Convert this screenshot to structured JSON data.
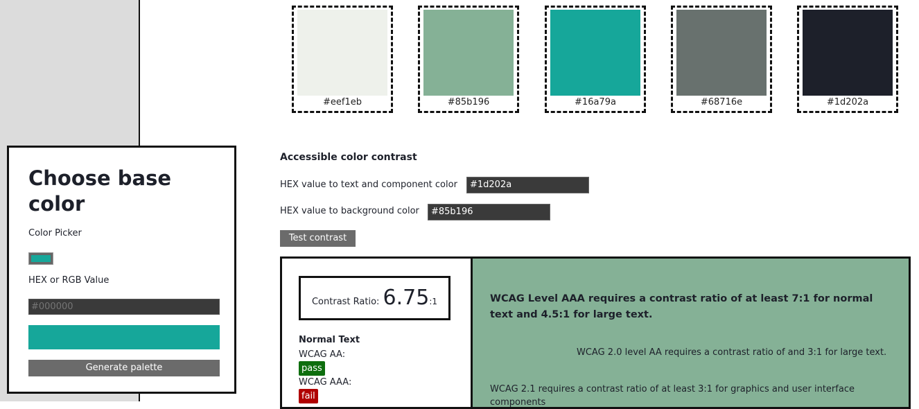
{
  "palette": [
    {
      "hex": "#eef1eb",
      "label": "#eef1eb"
    },
    {
      "hex": "#85b196",
      "label": "#85b196"
    },
    {
      "hex": "#16a79a",
      "label": "#16a79a"
    },
    {
      "hex": "#68716e",
      "label": "#68716e"
    },
    {
      "hex": "#1d202a",
      "label": "#1d202a"
    }
  ],
  "picker": {
    "title": "Choose base color",
    "color_picker_label": "Color Picker",
    "color_picker_value": "#16a79a",
    "hex_rgb_label": "HEX or RGB Value",
    "hex_input_placeholder": "#000000",
    "preview_color": "#16a79a",
    "generate_button": "Generate palette"
  },
  "contrast": {
    "heading": "Accessible color contrast",
    "text_color_label": "HEX value to text and component color",
    "text_color_value": "#1d202a",
    "bg_color_label": "HEX value to background color",
    "bg_color_value": "#85b196",
    "test_button": "Test contrast",
    "ratio_label": "Contrast Ratio:",
    "ratio_value": "6.75",
    "ratio_suffix": ":1",
    "normal_text_heading": "Normal Text",
    "levels": [
      {
        "label": "WCAG AA:",
        "result": "pass"
      },
      {
        "label": "WCAG AAA:",
        "result": "fail"
      }
    ],
    "aaa_requirement": "WCAG Level AAA requires a contrast ratio of at least 7:1 for normal text and 4.5:1 for large text.",
    "aa_requirement": "WCAG 2.0 level AA requires a contrast ratio of and 3:1 for large text.",
    "wcag21_requirement": "WCAG 2.1 requires a contrast ratio of at least 3:1 for graphics and user interface components"
  }
}
